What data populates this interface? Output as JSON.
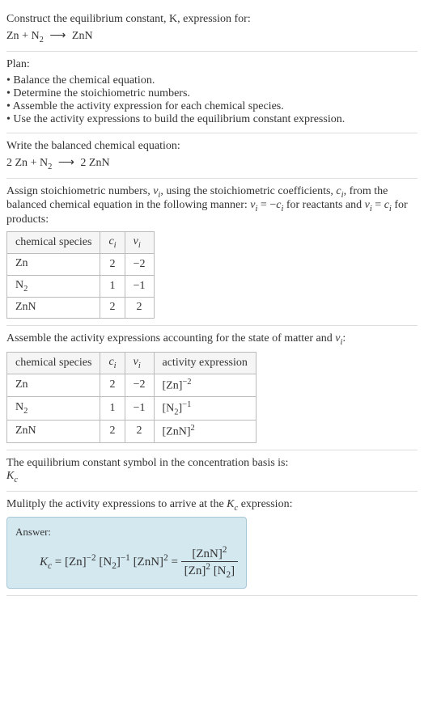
{
  "header": {
    "prompt": "Construct the equilibrium constant, K, expression for:",
    "equation_lhs1": "Zn",
    "equation_plus1": " + ",
    "equation_lhs2": "N",
    "equation_lhs2_sub": "2",
    "equation_arrow": " ⟶ ",
    "equation_rhs": "ZnN"
  },
  "plan": {
    "title": "Plan:",
    "items": [
      "Balance the chemical equation.",
      "Determine the stoichiometric numbers.",
      "Assemble the activity expression for each chemical species.",
      "Use the activity expressions to build the equilibrium constant expression."
    ]
  },
  "balanced": {
    "title": "Write the balanced chemical equation:",
    "eq_c1": "2 ",
    "eq_s1": "Zn",
    "eq_plus": " + ",
    "eq_s2": "N",
    "eq_s2_sub": "2",
    "eq_arrow": " ⟶ ",
    "eq_c2": "2 ",
    "eq_s3": "ZnN"
  },
  "stoich": {
    "intro1": "Assign stoichiometric numbers, ",
    "nu_i": "ν",
    "nu_i_sub": "i",
    "intro2": ", using the stoichiometric coefficients, ",
    "c_i": "c",
    "c_i_sub": "i",
    "intro3": ", from the balanced chemical equation in the following manner: ",
    "rel1a": "ν",
    "rel1a_sub": "i",
    "rel1_eq": " = −",
    "rel1b": "c",
    "rel1b_sub": "i",
    "intro4": " for reactants and ",
    "rel2a": "ν",
    "rel2a_sub": "i",
    "rel2_eq": " = ",
    "rel2b": "c",
    "rel2b_sub": "i",
    "intro5": " for products:",
    "table": {
      "headers": {
        "species": "chemical species",
        "ci": "c",
        "ci_sub": "i",
        "nui": "ν",
        "nui_sub": "i"
      },
      "rows": [
        {
          "species": "Zn",
          "species_sub": "",
          "ci": "2",
          "nui": "−2"
        },
        {
          "species": "N",
          "species_sub": "2",
          "ci": "1",
          "nui": "−1"
        },
        {
          "species": "ZnN",
          "species_sub": "",
          "ci": "2",
          "nui": "2"
        }
      ]
    }
  },
  "activity": {
    "intro1": "Assemble the activity expressions accounting for the state of matter and ",
    "nu": "ν",
    "nu_sub": "i",
    "intro2": ":",
    "table": {
      "headers": {
        "species": "chemical species",
        "ci": "c",
        "ci_sub": "i",
        "nui": "ν",
        "nui_sub": "i",
        "act": "activity expression"
      },
      "rows": [
        {
          "species": "Zn",
          "species_sub": "",
          "ci": "2",
          "nui": "−2",
          "act_base": "[Zn]",
          "act_sup": "−2"
        },
        {
          "species": "N",
          "species_sub": "2",
          "ci": "1",
          "nui": "−1",
          "act_base": "[N",
          "act_base_sub": "2",
          "act_base_close": "]",
          "act_sup": "−1"
        },
        {
          "species": "ZnN",
          "species_sub": "",
          "ci": "2",
          "nui": "2",
          "act_base": "[ZnN]",
          "act_sup": "2"
        }
      ]
    }
  },
  "symbol": {
    "line1": "The equilibrium constant symbol in the concentration basis is:",
    "kc": "K",
    "kc_sub": "c"
  },
  "multiply": {
    "line1a": "Mulitply the activity expressions to arrive at the ",
    "kc": "K",
    "kc_sub": "c",
    "line1b": " expression:"
  },
  "answer": {
    "label": "Answer:",
    "kc": "K",
    "kc_sub": "c",
    "eq": " = ",
    "t1": "[Zn]",
    "t1_sup": "−2",
    "sp1": " ",
    "t2a": "[N",
    "t2a_sub": "2",
    "t2b": "]",
    "t2_sup": "−1",
    "sp2": " ",
    "t3": "[ZnN]",
    "t3_sup": "2",
    "eq2": " = ",
    "num": "[ZnN]",
    "num_sup": "2",
    "den1": "[Zn]",
    "den1_sup": "2",
    "den_sp": " ",
    "den2a": "[N",
    "den2a_sub": "2",
    "den2b": "]"
  }
}
